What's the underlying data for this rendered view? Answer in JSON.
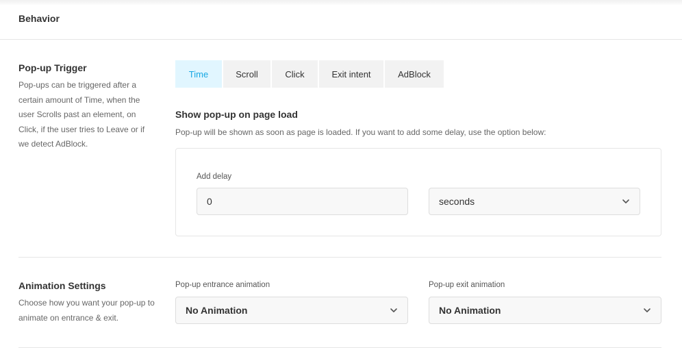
{
  "header": {
    "title": "Behavior"
  },
  "trigger": {
    "title": "Pop-up Trigger",
    "description": "Pop-ups can be triggered after a certain amount of Time, when the user Scrolls past an element, on Click, if the user tries to Leave or if we detect AdBlock.",
    "tabs": [
      {
        "label": "Time",
        "active": true
      },
      {
        "label": "Scroll",
        "active": false
      },
      {
        "label": "Click",
        "active": false
      },
      {
        "label": "Exit intent",
        "active": false
      },
      {
        "label": "AdBlock",
        "active": false
      }
    ],
    "time_panel": {
      "title": "Show pop-up on page load",
      "description": "Pop-up will be shown as soon as page is loaded. If you want to add some delay, use the option below:",
      "delay_label": "Add delay",
      "delay_value": "0",
      "unit_value": "seconds"
    }
  },
  "animation": {
    "title": "Animation Settings",
    "description": "Choose how you want your pop-up to animate on entrance & exit.",
    "entrance_label": "Pop-up entrance animation",
    "entrance_value": "No Animation",
    "exit_label": "Pop-up exit animation",
    "exit_value": "No Animation"
  },
  "colors": {
    "active_tab_bg": "#e1f6ff",
    "active_tab_text": "#17a8e3",
    "tab_bg": "#f2f2f2"
  },
  "icons": {
    "select_arrow": "chevron-down-icon"
  }
}
